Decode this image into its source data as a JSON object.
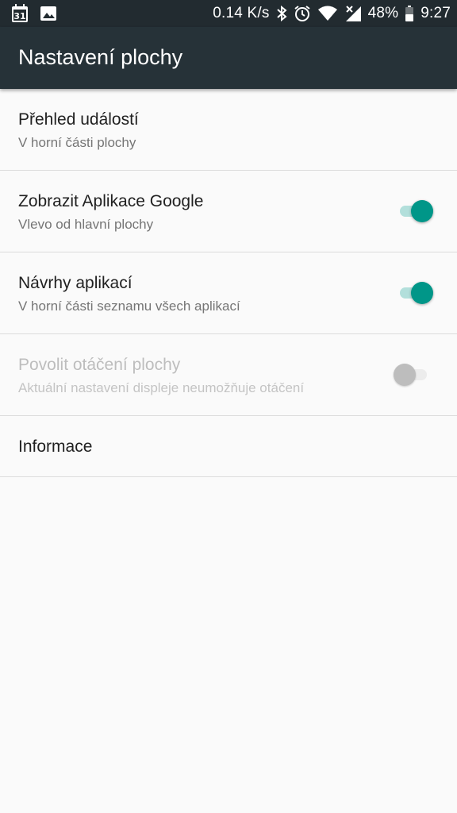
{
  "status_bar": {
    "calendar_day": "31",
    "net_speed": "0.14 K/s",
    "battery": "48%",
    "time": "9:27",
    "icons": [
      "calendar-icon",
      "image-icon",
      "bluetooth-icon",
      "alarm-icon",
      "wifi-icon",
      "signal-icon",
      "battery-icon"
    ]
  },
  "app_bar": {
    "title": "Nastavení plochy"
  },
  "settings": {
    "items": [
      {
        "title": "Přehled událostí",
        "summary": "V horní části plochy"
      },
      {
        "title": "Zobrazit Aplikace Google",
        "summary": "Vlevo od hlavní plochy",
        "switch": "on"
      },
      {
        "title": "Návrhy aplikací",
        "summary": "V horní části seznamu všech aplikací",
        "switch": "on"
      },
      {
        "title": "Povolit otáčení plochy",
        "summary": "Aktuální nastavení displeje neumožňuje otáčení",
        "switch": "off",
        "enabled": false
      },
      {
        "title": "Informace"
      }
    ]
  },
  "colors": {
    "status_bar": "#222b30",
    "app_bar": "#263238",
    "accent": "#009688",
    "accent_track": "#b2dfdb",
    "background": "#fafafa"
  }
}
